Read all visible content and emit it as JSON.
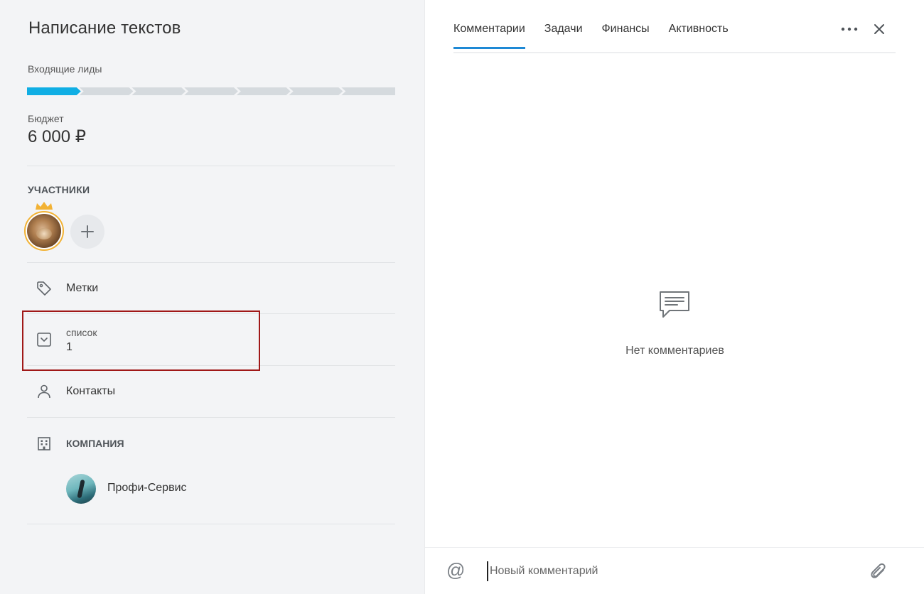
{
  "deal": {
    "title": "Написание текстов",
    "stage_label": "Входящие лиды",
    "stages": [
      {
        "active": true
      },
      {
        "active": false
      },
      {
        "active": false
      },
      {
        "active": false
      },
      {
        "active": false
      },
      {
        "active": false
      },
      {
        "active": false
      }
    ],
    "budget_label": "Бюджет",
    "budget_value": "6 000 ₽"
  },
  "participants": {
    "heading": "УЧАСТНИКИ",
    "owner_icon": "crown-icon",
    "add_icon": "plus-icon"
  },
  "fields": {
    "tags_label": "Метки",
    "list_label": "список",
    "list_value": "1",
    "contacts_label": "Контакты",
    "company_heading": "КОМПАНИЯ",
    "company_name": "Профи-Сервис"
  },
  "tabs": [
    {
      "label": "Комментарии",
      "active": true
    },
    {
      "label": "Задачи",
      "active": false
    },
    {
      "label": "Финансы",
      "active": false
    },
    {
      "label": "Активность",
      "active": false
    }
  ],
  "comments": {
    "empty_text": "Нет комментариев",
    "placeholder": "Новый комментарий",
    "mention_symbol": "@"
  },
  "colors": {
    "accent": "#1e89d5",
    "stage_active": "#10aee4",
    "stage_inactive": "#d5dade",
    "owner_ring": "#f2b234",
    "highlight": "#a01818"
  }
}
